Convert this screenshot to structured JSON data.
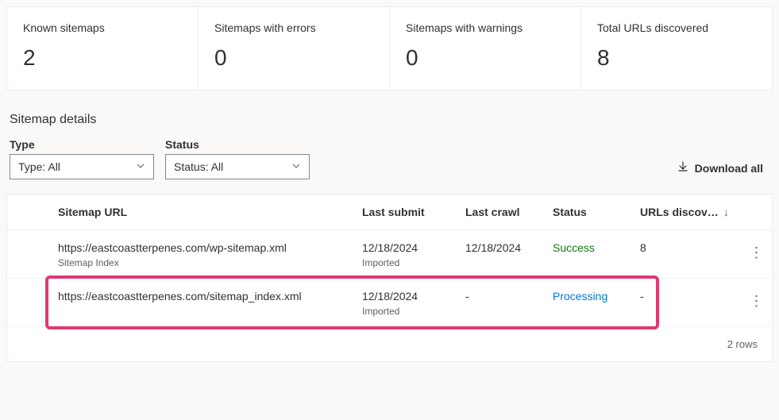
{
  "stats": [
    {
      "label": "Known sitemaps",
      "value": "2"
    },
    {
      "label": "Sitemaps with errors",
      "value": "0"
    },
    {
      "label": "Sitemaps with warnings",
      "value": "0"
    },
    {
      "label": "Total URLs discovered",
      "value": "8"
    }
  ],
  "section": {
    "title": "Sitemap details"
  },
  "filters": {
    "type": {
      "label": "Type",
      "value": "Type: All"
    },
    "status": {
      "label": "Status",
      "value": "Status: All"
    }
  },
  "actions": {
    "download_all": "Download all"
  },
  "table": {
    "columns": {
      "url": "Sitemap URL",
      "last_submit": "Last submit",
      "last_crawl": "Last crawl",
      "status": "Status",
      "urls_discov": "URLs discov…"
    },
    "rows": [
      {
        "url": "https://eastcoastterpenes.com/wp-sitemap.xml",
        "url_sub": "Sitemap Index",
        "last_submit": "12/18/2024",
        "submit_sub": "Imported",
        "last_crawl": "12/18/2024",
        "status": "Success",
        "status_class": "status-success",
        "urls": "8",
        "highlight": false
      },
      {
        "url": "https://eastcoastterpenes.com/sitemap_index.xml",
        "url_sub": "",
        "last_submit": "12/18/2024",
        "submit_sub": "Imported",
        "last_crawl": "-",
        "status": "Processing",
        "status_class": "status-processing",
        "urls": "-",
        "highlight": true
      }
    ],
    "footer": "2 rows"
  }
}
